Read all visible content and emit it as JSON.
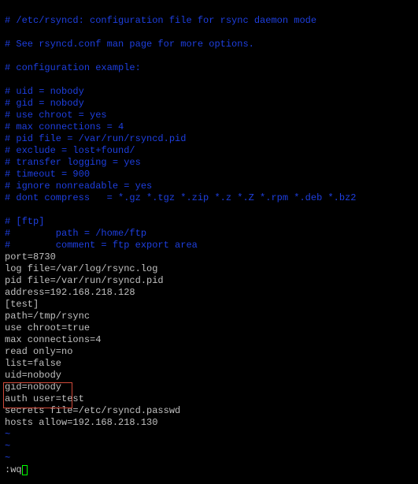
{
  "lines": {
    "c1": "# /etc/rsyncd: configuration file for rsync daemon mode",
    "c2": "",
    "c3": "# See rsyncd.conf man page for more options.",
    "c4": "",
    "c5": "# configuration example:",
    "c6": "",
    "c7": "# uid = nobody",
    "c8": "# gid = nobody",
    "c9": "# use chroot = yes",
    "c10": "# max connections = 4",
    "c11": "# pid file = /var/run/rsyncd.pid",
    "c12": "# exclude = lost+found/",
    "c13": "# transfer logging = yes",
    "c14": "# timeout = 900",
    "c15": "# ignore nonreadable = yes",
    "c16": "# dont compress   = *.gz *.tgz *.zip *.z *.Z *.rpm *.deb *.bz2",
    "c17": "",
    "c18": "# [ftp]",
    "c19": "#        path = /home/ftp",
    "c20": "#        comment = ftp export area",
    "p1": "port=8730",
    "p2": "log file=/var/log/rsync.log",
    "p3": "pid file=/var/run/rsyncd.pid",
    "p4": "address=192.168.218.128",
    "p5": "[test]",
    "p6": "path=/tmp/rsync",
    "p7": "use chroot=true",
    "p8": "max connections=4",
    "p9": "read only=no",
    "p10": "list=false",
    "p11": "uid=nobody",
    "p12": "gid=nobody",
    "p13": "auth user=test",
    "p14": "secrets file=/etc/rsyncd.passwd",
    "p15": "hosts allow=192.168.218.130",
    "t1": "~",
    "t2": "~",
    "t3": "~",
    "cmd": ":wq"
  }
}
